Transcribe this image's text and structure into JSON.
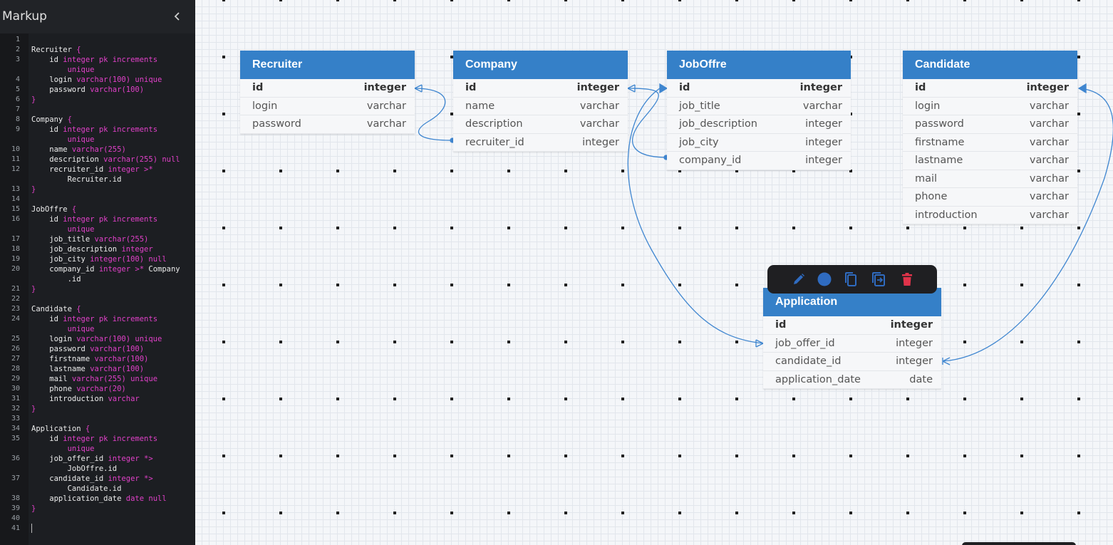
{
  "sidebar": {
    "title": "Markup",
    "collapse_icon": "chevron-left-icon",
    "lines": [
      {
        "n": "1",
        "html": ""
      },
      {
        "n": "2",
        "html": "Recruiter <span class='br'>{</span>"
      },
      {
        "n": "3",
        "html": "    id <span class='kw'>integer pk increments</span>"
      },
      {
        "n": "",
        "html": "        <span class='kw'>unique</span>"
      },
      {
        "n": "4",
        "html": "    login <span class='kw'>varchar(100) unique</span>"
      },
      {
        "n": "5",
        "html": "    password <span class='kw'>varchar(100)</span>"
      },
      {
        "n": "6",
        "html": "<span class='br'>}</span>"
      },
      {
        "n": "7",
        "html": ""
      },
      {
        "n": "8",
        "html": "Company <span class='br'>{</span>"
      },
      {
        "n": "9",
        "html": "    id <span class='kw'>integer pk increments</span>"
      },
      {
        "n": "",
        "html": "        <span class='kw'>unique</span>"
      },
      {
        "n": "10",
        "html": "    name <span class='kw'>varchar(255)</span>"
      },
      {
        "n": "11",
        "html": "    description <span class='kw'>varchar(255) null</span>"
      },
      {
        "n": "12",
        "html": "    recruiter_id <span class='kw'>integer &gt;*</span>"
      },
      {
        "n": "",
        "html": "        Recruiter.id"
      },
      {
        "n": "13",
        "html": "<span class='br'>}</span>"
      },
      {
        "n": "14",
        "html": ""
      },
      {
        "n": "15",
        "html": "JobOffre <span class='br'>{</span>"
      },
      {
        "n": "16",
        "html": "    id <span class='kw'>integer pk increments</span>"
      },
      {
        "n": "",
        "html": "        <span class='kw'>unique</span>"
      },
      {
        "n": "17",
        "html": "    job_title <span class='kw'>varchar(255)</span>"
      },
      {
        "n": "18",
        "html": "    job_description <span class='kw'>integer</span>"
      },
      {
        "n": "19",
        "html": "    job_city <span class='kw'>integer(100) null</span>"
      },
      {
        "n": "20",
        "html": "    company_id <span class='kw'>integer &gt;*</span> Company"
      },
      {
        "n": "",
        "html": "        .id"
      },
      {
        "n": "21",
        "html": "<span class='br'>}</span>"
      },
      {
        "n": "22",
        "html": ""
      },
      {
        "n": "23",
        "html": "Candidate <span class='br'>{</span>"
      },
      {
        "n": "24",
        "html": "    id <span class='kw'>integer pk increments</span>"
      },
      {
        "n": "",
        "html": "        <span class='kw'>unique</span>"
      },
      {
        "n": "25",
        "html": "    login <span class='kw'>varchar(100) unique</span>"
      },
      {
        "n": "26",
        "html": "    password <span class='kw'>varchar(100)</span>"
      },
      {
        "n": "27",
        "html": "    firstname <span class='kw'>varchar(100)</span>"
      },
      {
        "n": "28",
        "html": "    lastname <span class='kw'>varchar(100)</span>"
      },
      {
        "n": "29",
        "html": "    mail <span class='kw'>varchar(255) unique</span>"
      },
      {
        "n": "30",
        "html": "    phone <span class='kw'>varchar(20)</span>"
      },
      {
        "n": "31",
        "html": "    introduction <span class='kw'>varchar</span>"
      },
      {
        "n": "32",
        "html": "<span class='br'>}</span>"
      },
      {
        "n": "33",
        "html": ""
      },
      {
        "n": "34",
        "html": "Application <span class='br'>{</span>"
      },
      {
        "n": "35",
        "html": "    id <span class='kw'>integer pk increments</span>"
      },
      {
        "n": "",
        "html": "        <span class='kw'>unique</span>"
      },
      {
        "n": "36",
        "html": "    job_offer_id <span class='kw'>integer *&gt;</span>"
      },
      {
        "n": "",
        "html": "        JobOffre.id"
      },
      {
        "n": "37",
        "html": "    candidate_id <span class='kw'>integer *&gt;</span>"
      },
      {
        "n": "",
        "html": "        Candidate.id"
      },
      {
        "n": "38",
        "html": "    application_date <span class='kw'>date null</span>"
      },
      {
        "n": "39",
        "html": "<span class='br'>}</span>"
      },
      {
        "n": "40",
        "html": ""
      },
      {
        "n": "41",
        "html": ""
      }
    ]
  },
  "tables": [
    {
      "key": "recruiter",
      "name": "Recruiter",
      "fields": [
        {
          "name": "id",
          "type": "integer",
          "pk": true
        },
        {
          "name": "login",
          "type": "varchar"
        },
        {
          "name": "password",
          "type": "varchar"
        }
      ]
    },
    {
      "key": "company",
      "name": "Company",
      "fields": [
        {
          "name": "id",
          "type": "integer",
          "pk": true
        },
        {
          "name": "name",
          "type": "varchar"
        },
        {
          "name": "description",
          "type": "varchar"
        },
        {
          "name": "recruiter_id",
          "type": "integer"
        }
      ]
    },
    {
      "key": "joboffre",
      "name": "JobOffre",
      "fields": [
        {
          "name": "id",
          "type": "integer",
          "pk": true
        },
        {
          "name": "job_title",
          "type": "varchar"
        },
        {
          "name": "job_description",
          "type": "integer"
        },
        {
          "name": "job_city",
          "type": "integer"
        },
        {
          "name": "company_id",
          "type": "integer"
        }
      ]
    },
    {
      "key": "candidate",
      "name": "Candidate",
      "fields": [
        {
          "name": "id",
          "type": "integer",
          "pk": true
        },
        {
          "name": "login",
          "type": "varchar"
        },
        {
          "name": "password",
          "type": "varchar"
        },
        {
          "name": "firstname",
          "type": "varchar"
        },
        {
          "name": "lastname",
          "type": "varchar"
        },
        {
          "name": "mail",
          "type": "varchar"
        },
        {
          "name": "phone",
          "type": "varchar"
        },
        {
          "name": "introduction",
          "type": "varchar"
        }
      ]
    },
    {
      "key": "application",
      "name": "Application",
      "fields": [
        {
          "name": "id",
          "type": "integer",
          "pk": true
        },
        {
          "name": "job_offer_id",
          "type": "integer"
        },
        {
          "name": "candidate_id",
          "type": "integer"
        },
        {
          "name": "application_date",
          "type": "date"
        }
      ]
    }
  ],
  "toolbar": {
    "icons": [
      "pencil-icon",
      "color-dot-icon",
      "copy-icon",
      "duplicate-icon",
      "trash-icon"
    ],
    "accent": "#2f6bc0",
    "danger": "#e0334a"
  },
  "colors": {
    "header": "#3580c8",
    "link": "#3f86d0"
  }
}
